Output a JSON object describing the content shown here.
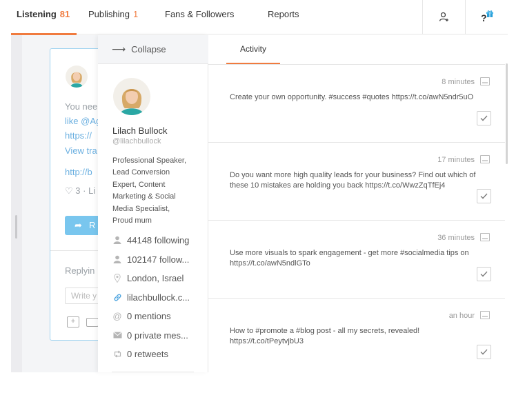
{
  "nav": {
    "tabs": [
      {
        "label": "Listening",
        "count": "81"
      },
      {
        "label": "Publishing",
        "count": "1"
      },
      {
        "label": "Fans & Followers",
        "count": ""
      },
      {
        "label": "Reports",
        "count": ""
      }
    ]
  },
  "background": {
    "lines": [
      "You nee",
      "like @Ag",
      "https://",
      "View tra",
      "http://b",
      "♡ 3 · Li",
      "Replyin"
    ],
    "reply_button": "R",
    "input_placeholder": "Write y"
  },
  "profile": {
    "collapse_label": "Collapse",
    "name": "Lilach Bullock",
    "handle": "@lilachbullock",
    "bio_lines": [
      "Professional Speaker,",
      "Lead Conversion",
      "Expert, Content",
      "Marketing & Social",
      "Media Specialist,",
      "Proud mum"
    ],
    "stats": [
      {
        "icon": "user-icon",
        "text": "44148 following"
      },
      {
        "icon": "user-icon",
        "text": "102147 follow..."
      },
      {
        "icon": "location-pin-icon",
        "text": "London, Israel"
      },
      {
        "icon": "link-icon",
        "text": "lilachbullock.c..."
      },
      {
        "icon": "at-icon",
        "text": "0 mentions"
      },
      {
        "icon": "envelope-icon",
        "text": "0 private mes..."
      },
      {
        "icon": "retweet-icon",
        "text": "0 retweets"
      }
    ]
  },
  "activity": {
    "tab_label": "Activity",
    "items": [
      {
        "time": "8 minutes",
        "text": "Create your own opportunity. #success #quotes https://t.co/awN5ndr5uO"
      },
      {
        "time": "17 minutes",
        "text": "Do you want more high quality leads for your business? Find out which of these 10 mistakes are holding you back https://t.co/WwzZqTfEj4"
      },
      {
        "time": "36 minutes",
        "text": "Use more visuals to spark engagement - get more #socialmedia tips on https://t.co/awN5ndlGTo"
      },
      {
        "time": "an hour",
        "text": "How to #promote a #blog post - all my secrets, revealed! https://t.co/tPeytvjbU3"
      }
    ]
  },
  "colors": {
    "accent": "#f07b3f",
    "link": "#4aa3df",
    "reply_button": "#79c6ee"
  }
}
